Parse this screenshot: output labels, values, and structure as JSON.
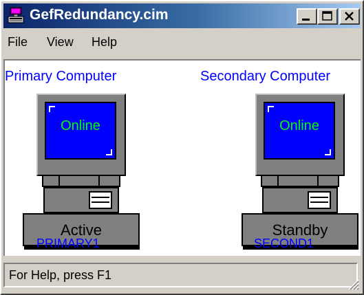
{
  "window": {
    "title": "GefRedundancy.cim",
    "controls": [
      "minimize",
      "maximize",
      "close"
    ]
  },
  "menu": {
    "items": [
      "File",
      "View",
      "Help"
    ]
  },
  "primary": {
    "title": "Primary Computer",
    "screen_text": "Online",
    "state": "Active",
    "hostname": "PRIMARY1"
  },
  "secondary": {
    "title": "Secondary Computer",
    "screen_text": "Online",
    "state": "Standby",
    "hostname": "SECOND1"
  },
  "status": {
    "text": "For Help, press F1"
  },
  "colors": {
    "titlebar_start": "#0a246a",
    "titlebar_end": "#a6caf0",
    "label_blue": "#0000ff",
    "screen_blue": "#0000ff",
    "screen_text_green": "#00ff00",
    "face": "#d4d0c8",
    "computer_gray": "#808080"
  },
  "icons": {
    "app": "computer-app-icon",
    "minimize": "minimize-icon",
    "maximize": "maximize-icon",
    "close": "close-icon",
    "resize": "resize-grip-icon"
  }
}
